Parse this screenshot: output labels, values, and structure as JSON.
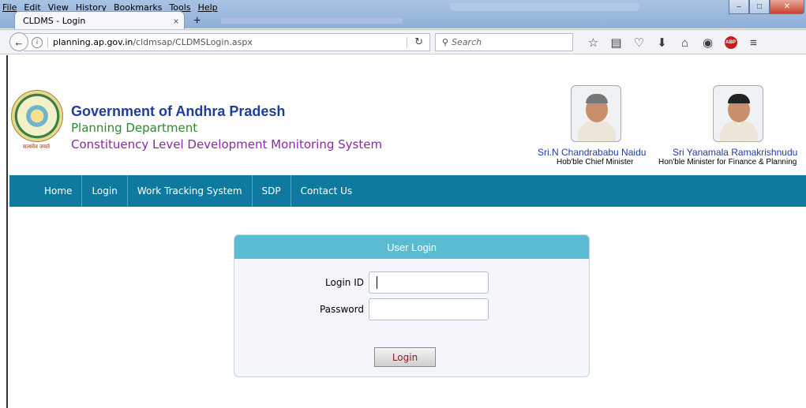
{
  "browser": {
    "menu": [
      "File",
      "Edit",
      "View",
      "History",
      "Bookmarks",
      "Tools",
      "Help"
    ],
    "tab_title": "CLDMS - Login",
    "tab_close": "×",
    "new_tab": "+",
    "url_host": "planning.ap.gov.in",
    "url_path": "/cldmsap/CLDMSLogin.aspx",
    "search_placeholder": "Search"
  },
  "header": {
    "gov_title": "Government of Andhra Pradesh",
    "department": "Planning Department",
    "system": "Constituency Level Development Monitoring System",
    "emblem_text": "सत्यमेव जयते",
    "person1_name": "Sri.N Chandrababu Naidu",
    "person1_role": "Hob'ble Chief Minister",
    "person2_name": "Sri Yanamala Ramakrishnudu",
    "person2_role": "Hon'ble Minister for Finance & Planning"
  },
  "nav": {
    "items": [
      "Home",
      "Login",
      "Work Tracking System",
      "SDP",
      "Contact Us"
    ]
  },
  "login": {
    "title": "User Login",
    "login_id_label": "Login ID",
    "login_id_value": "",
    "password_label": "Password",
    "password_value": "",
    "button": "Login"
  },
  "colors": {
    "nav_bg": "#0f7aa0",
    "panel_header": "#5bbbd0",
    "gov_title": "#1f3e9c",
    "department": "#2d8a2d",
    "system": "#8b2aa6"
  }
}
